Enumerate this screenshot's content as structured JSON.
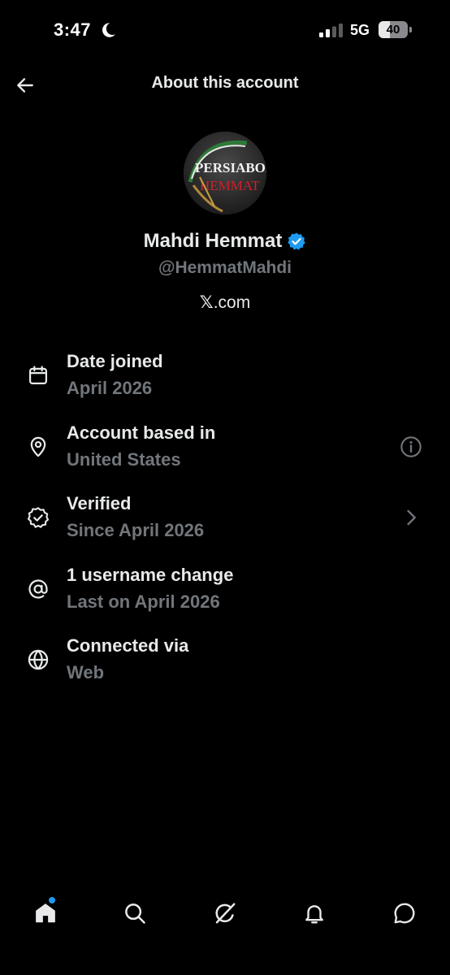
{
  "status_bar": {
    "time": "3:47",
    "network": "5G",
    "battery_percent": 40,
    "battery_label": "40"
  },
  "header": {
    "title": "About this account"
  },
  "profile": {
    "display_name": "Mahdi Hemmat",
    "handle": "@HemmatMahdi",
    "site_prefix": "𝕏",
    "site_suffix": ".com",
    "avatar_text_top": "PERSIABOI",
    "avatar_text_bottom": "HEMMAT",
    "verified": true
  },
  "info_rows": [
    {
      "title": "Date joined",
      "value": "April 2026",
      "icon": "calendar-icon"
    },
    {
      "title": "Account based in",
      "value": "United States",
      "icon": "location-pin-icon",
      "action": "info-icon"
    },
    {
      "title": "Verified",
      "value": "Since April 2026",
      "icon": "verified-check-icon",
      "action": "chevron-right-icon"
    },
    {
      "title": "1 username change",
      "value": "Last on April 2026",
      "icon": "at-sign-icon"
    },
    {
      "title": "Connected via",
      "value": "Web",
      "icon": "globe-icon"
    }
  ],
  "bottom_nav": {
    "items": [
      "home-icon",
      "search-icon",
      "grok-icon",
      "notifications-bell-icon",
      "messages-icon"
    ],
    "home_has_badge": true
  },
  "colors": {
    "background": "#000000",
    "primary_text": "#e7e9ea",
    "secondary_text": "#71767b",
    "accent_blue": "#1d9bf0"
  }
}
